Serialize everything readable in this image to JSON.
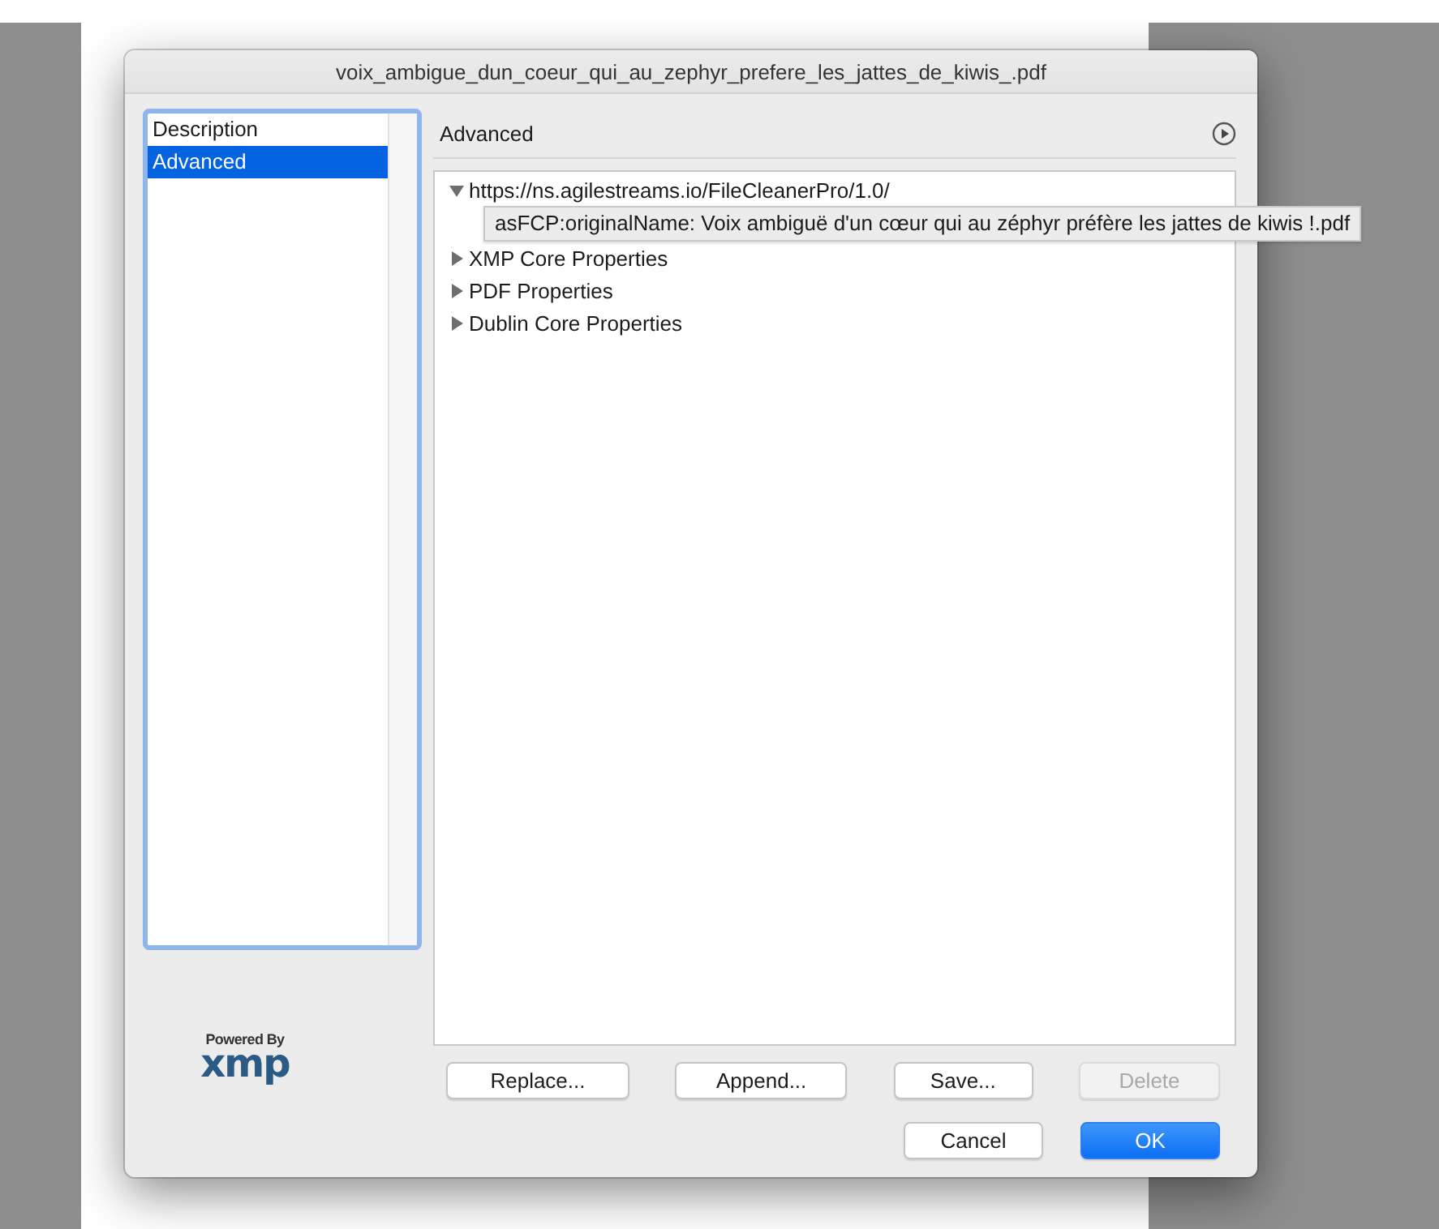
{
  "window": {
    "title": "voix_ambigue_dun_coeur_qui_au_zephyr_prefere_les_jattes_de_kiwis_.pdf"
  },
  "categories": [
    {
      "label": "Description",
      "selected": false
    },
    {
      "label": "Advanced",
      "selected": true
    }
  ],
  "panel": {
    "title": "Advanced"
  },
  "tree": [
    {
      "label": "https://ns.agilestreams.io/FileCleanerPro/1.0/",
      "expanded": true,
      "children": [
        {
          "label": "asFCP:originalName: Voix ambiguë d'un cœur qui au zéphyr préfère les jattes de kiwis !.pdf"
        }
      ]
    },
    {
      "label": "XMP Core Properties",
      "expanded": false
    },
    {
      "label": "PDF Properties",
      "expanded": false
    },
    {
      "label": "Dublin Core Properties",
      "expanded": false
    }
  ],
  "logo": {
    "caption": "Powered By",
    "wordmark": "xmp"
  },
  "buttons": [
    {
      "label": "Replace...",
      "disabled": false
    },
    {
      "label": "Append...",
      "disabled": false
    },
    {
      "label": "Save...",
      "disabled": false
    },
    {
      "label": "Delete",
      "disabled": true
    }
  ],
  "dialog_buttons": [
    {
      "label": "Cancel",
      "default": false
    },
    {
      "label": "OK",
      "default": true
    }
  ]
}
